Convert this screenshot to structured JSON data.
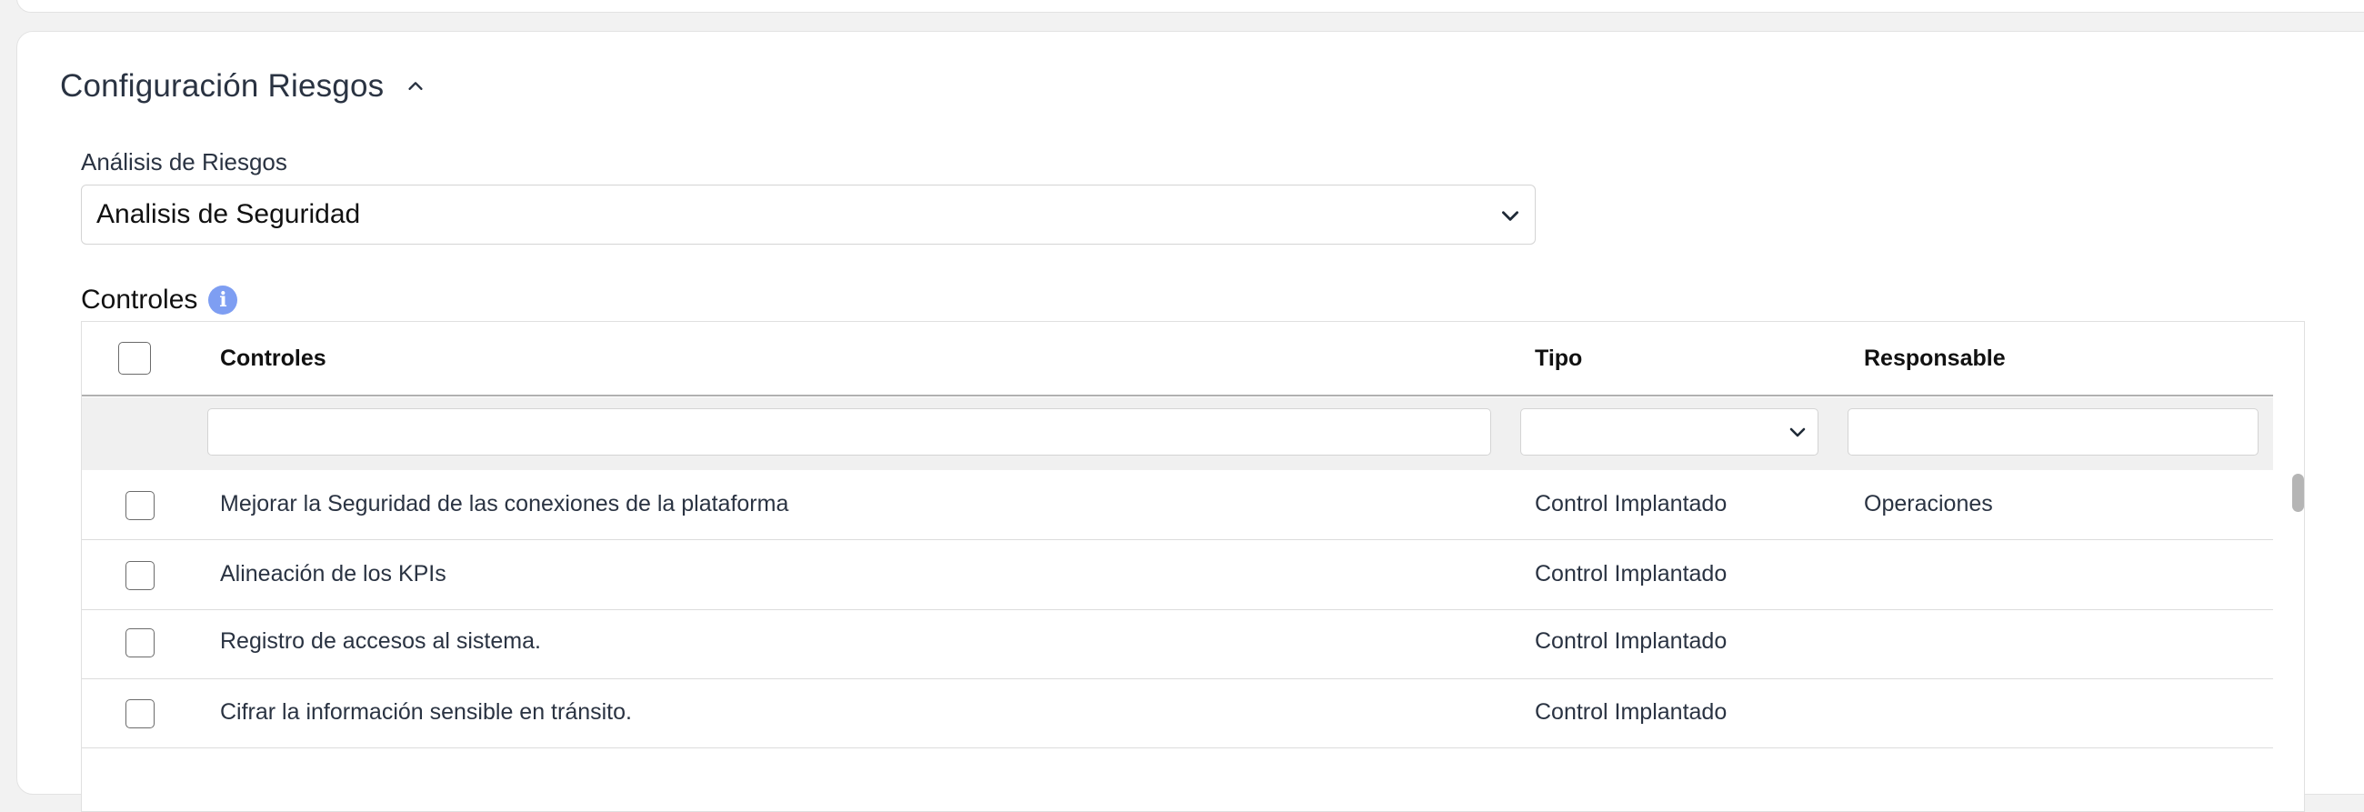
{
  "section": {
    "title": "Configuración Riesgos"
  },
  "analysis": {
    "label": "Análisis de Riesgos",
    "selected": "Analisis de Seguridad"
  },
  "controls": {
    "heading": "Controles",
    "columns": {
      "controles": "Controles",
      "tipo": "Tipo",
      "responsable": "Responsable"
    },
    "rows": [
      {
        "control": "Mejorar la Seguridad de las conexiones de la plataforma",
        "tipo": "Control Implantado",
        "responsable": "Operaciones"
      },
      {
        "control": "Alineación de los KPIs",
        "tipo": "Control Implantado",
        "responsable": ""
      },
      {
        "control": "Registro de accesos al sistema.",
        "tipo": "Control Implantado",
        "responsable": ""
      },
      {
        "control": "Cifrar la información sensible en tránsito.",
        "tipo": "Control Implantado",
        "responsable": ""
      }
    ]
  },
  "icons": {
    "collapse": "chevron-up-icon",
    "select": "chevron-down-icon",
    "info": "info-icon"
  },
  "colors": {
    "info_badge": "#7e9ef2",
    "filter_row": "#f0f0f0"
  }
}
